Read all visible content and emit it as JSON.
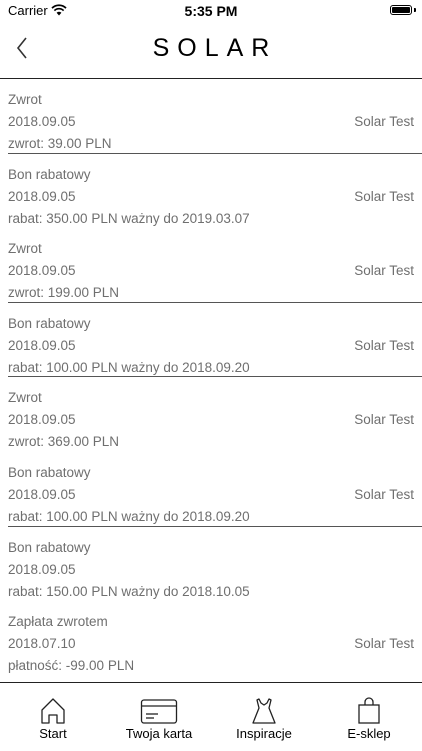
{
  "status_bar": {
    "carrier": "Carrier",
    "time": "5:35 PM"
  },
  "header": {
    "title": "SOLAR"
  },
  "history": [
    {
      "type": "Zwrot",
      "date": "2018.09.05",
      "store": "Solar Test",
      "detail": "zwrot: 39.00 PLN"
    },
    {
      "type": "Bon rabatowy",
      "date": "2018.09.05",
      "store": "Solar Test",
      "detail": "rabat: 350.00 PLN ważny do 2019.03.07"
    },
    {
      "type": "Zwrot",
      "date": "2018.09.05",
      "store": "Solar Test",
      "detail": "zwrot: 199.00 PLN"
    },
    {
      "type": "Bon rabatowy",
      "date": "2018.09.05",
      "store": "Solar Test",
      "detail": "rabat: 100.00 PLN ważny do 2018.09.20"
    },
    {
      "type": "Zwrot",
      "date": "2018.09.05",
      "store": "Solar Test",
      "detail": "zwrot: 369.00 PLN"
    },
    {
      "type": "Bon rabatowy",
      "date": "2018.09.05",
      "store": "Solar Test",
      "detail": "rabat: 100.00 PLN ważny do 2018.09.20"
    },
    {
      "type": "Bon rabatowy",
      "date": "2018.09.05",
      "store": "",
      "detail": "rabat: 150.00 PLN ważny do 2018.10.05"
    },
    {
      "type": "Zapłata zwrotem",
      "date": "2018.07.10",
      "store": "Solar Test",
      "detail": "płatność: -99.00 PLN"
    }
  ],
  "tabs": [
    {
      "label": "Start",
      "icon": "home-icon"
    },
    {
      "label": "Twoja karta",
      "icon": "card-icon"
    },
    {
      "label": "Inspiracje",
      "icon": "dress-icon"
    },
    {
      "label": "E-sklep",
      "icon": "bag-icon"
    }
  ]
}
